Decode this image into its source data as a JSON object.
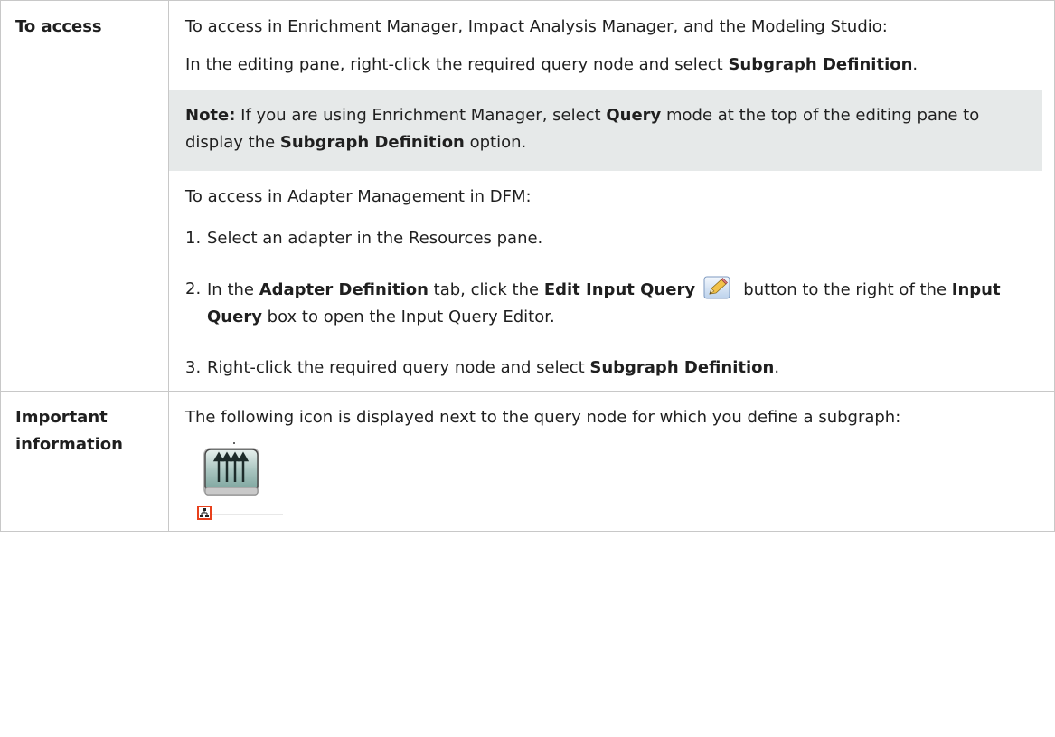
{
  "row1": {
    "header": "To access",
    "intro": "To access in Enrichment Manager, Impact Analysis Manager, and the Modeling Studio:",
    "editing_pre": "In the editing pane, right-click the required query node and select ",
    "editing_bold": "Subgraph Definition",
    "editing_post": ".",
    "note": {
      "label": "Note:",
      "t1": " If you are using Enrichment Manager, select ",
      "b1": "Query",
      "t2": " mode at the top of the editing pane to display the ",
      "b2": "Subgraph Definition",
      "t3": " option."
    },
    "adapter_intro": "To access in Adapter Management in DFM:",
    "steps": [
      {
        "num": "1.",
        "text": "Select an adapter in the Resources pane."
      },
      {
        "num": "2.",
        "t1": "In the ",
        "b1": "Adapter Definition",
        "t2": " tab, click the ",
        "b2": "Edit Input Query",
        "t3": " button to the right of the ",
        "b3": "Input Query",
        "t4": " box to open the Input Query Editor."
      },
      {
        "num": "3.",
        "t1": "Right-click the required query node and select ",
        "b1": "Subgraph Definition",
        "t2": "."
      }
    ]
  },
  "row2": {
    "header_line1": "Important",
    "header_line2": "information",
    "text": "The following icon is displayed next to the query node for which you define a subgraph:"
  },
  "icons": {
    "edit_input_query": "pencil-icon",
    "subgraph_node": "subgraph-query-node-icon"
  },
  "colors": {
    "note_background": "#e6e9e9",
    "table_border": "#c8c8c8",
    "subgraph_badge": "#e8401c"
  }
}
